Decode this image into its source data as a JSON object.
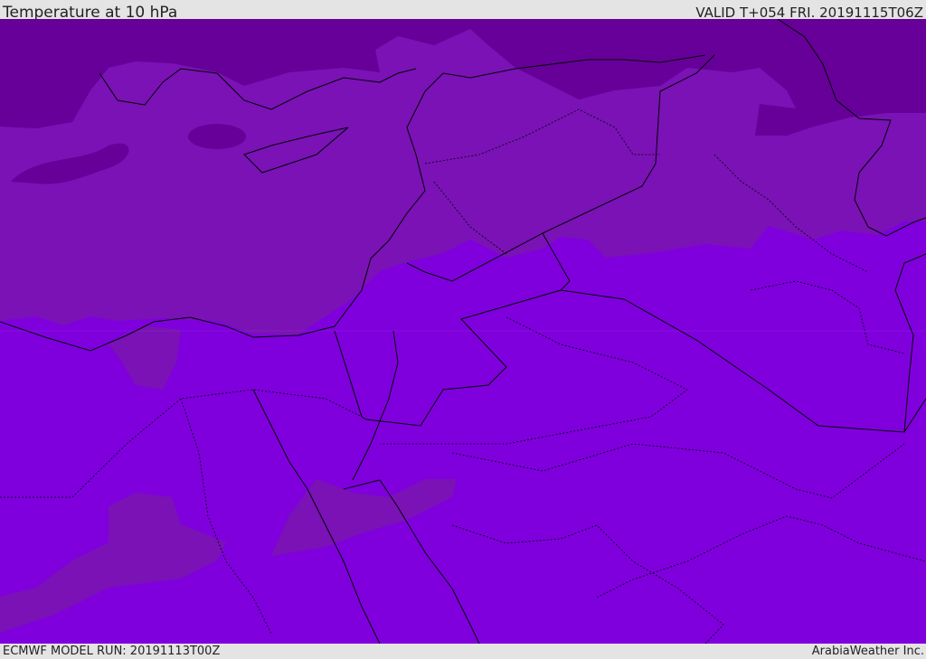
{
  "header": {
    "title": "Temperature at 10 hPa",
    "valid": "VALID T+054 FRI. 20191115T06Z"
  },
  "footer": {
    "model_run": "ECMWF MODEL RUN: 20191113T00Z",
    "brand": "ArabiaWeather Inc."
  },
  "colors": {
    "coldest": "#660099",
    "mid": "#7a12b6",
    "warm": "#7f00dd",
    "boundary": "#000000"
  }
}
